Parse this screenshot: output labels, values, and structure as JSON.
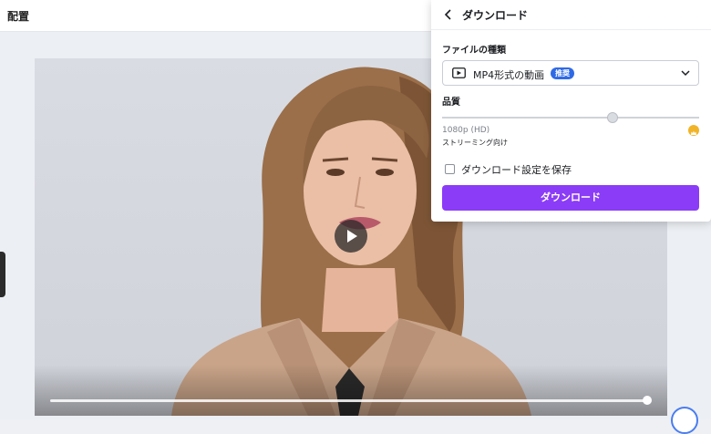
{
  "header": {
    "title": "配置"
  },
  "panel": {
    "title": "ダウンロード",
    "file_type_label": "ファイルの種類",
    "file_type_value": "MP4形式の動画",
    "recommended_badge": "推奨",
    "quality_label": "品質",
    "quality_value": "1080p (HD)",
    "quality_description": "ストリーミング向け",
    "quality_level_fraction": 0.67,
    "save_settings_label": "ダウンロード設定を保存",
    "save_settings_checked": false,
    "download_button_label": "ダウンロード"
  },
  "video": {
    "progress_fraction": 1.0
  },
  "colors": {
    "accent_purple": "#8b3cf7",
    "badge_blue": "#2f6ae6",
    "premium_gold": "#f1b428"
  },
  "icons": [
    "back-arrow-icon",
    "video-file-icon",
    "chevron-down-icon",
    "crown-icon",
    "play-icon"
  ]
}
